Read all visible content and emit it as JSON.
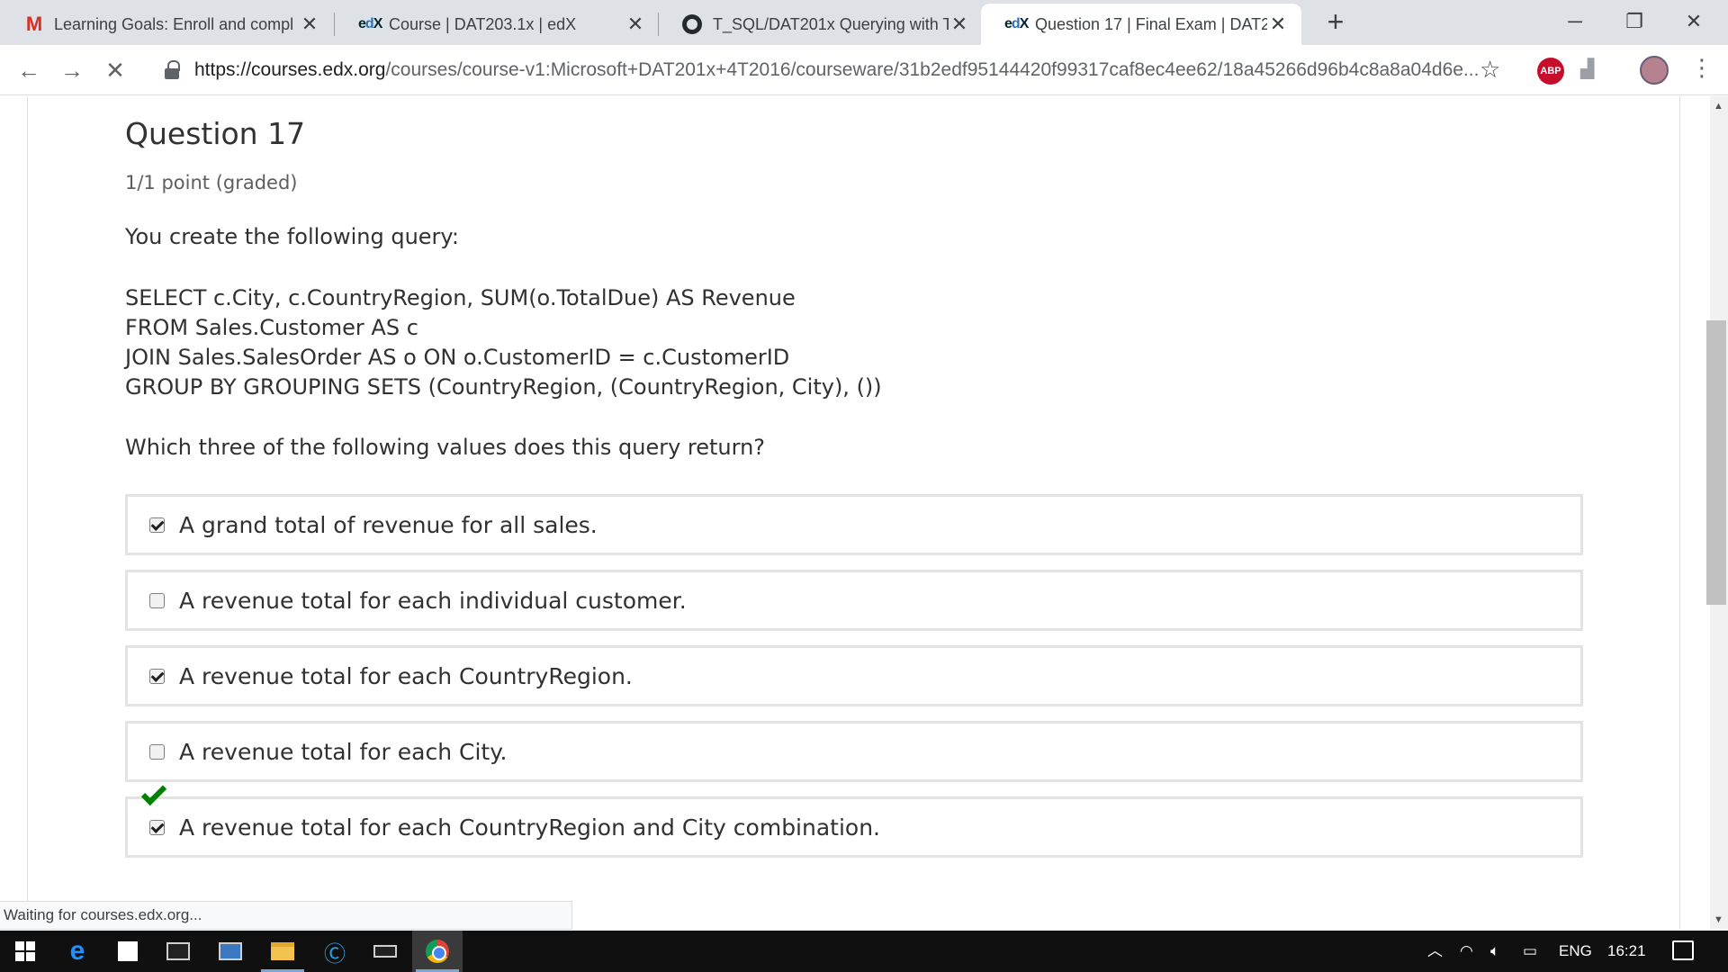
{
  "browser": {
    "tabs": [
      {
        "favicon": "gmail-icon",
        "title": "Learning Goals: Enroll and compl",
        "active": false
      },
      {
        "favicon": "edx-icon",
        "title": "Course | DAT203.1x | edX",
        "active": false
      },
      {
        "favicon": "github-icon",
        "title": "T_SQL/DAT201x Querying with Tr",
        "active": false
      },
      {
        "favicon": "edx-icon",
        "title": "Question 17 | Final Exam | DAT20",
        "active": true
      }
    ],
    "new_tab_label": "+",
    "url_host": "https://courses.edx.org",
    "url_path": "/courses/course-v1:Microsoft+DAT201x+4T2016/courseware/31b2edf95144420f99317caf8ec4ee62/18a45266d96b4c8a8a04d6e...",
    "abp_label": "ABP",
    "status_text": "Waiting for courses.edx.org..."
  },
  "question": {
    "title": "Question 17",
    "points": "1/1 point (graded)",
    "prompt": "You create the following query:",
    "query_lines": [
      "SELECT c.City, c.CountryRegion, SUM(o.TotalDue) AS Revenue",
      "FROM Sales.Customer AS c",
      "JOIN Sales.SalesOrder AS o ON o.CustomerID = c.CustomerID",
      "GROUP BY GROUPING SETS (CountryRegion, (CountryRegion, City), ())"
    ],
    "ask": "Which three of the following values does this query return?",
    "options": [
      {
        "label": "A grand total of revenue for all sales.",
        "checked": true
      },
      {
        "label": "A revenue total for each individual customer.",
        "checked": false
      },
      {
        "label": "A revenue total for each CountryRegion.",
        "checked": true
      },
      {
        "label": "A revenue total for each City.",
        "checked": false
      },
      {
        "label": "A revenue total for each CountryRegion and City combination.",
        "checked": true
      }
    ],
    "result_icon": "checkmark-icon",
    "result_color": "#008100"
  },
  "taskbar": {
    "language": "ENG",
    "time": "16:21"
  }
}
